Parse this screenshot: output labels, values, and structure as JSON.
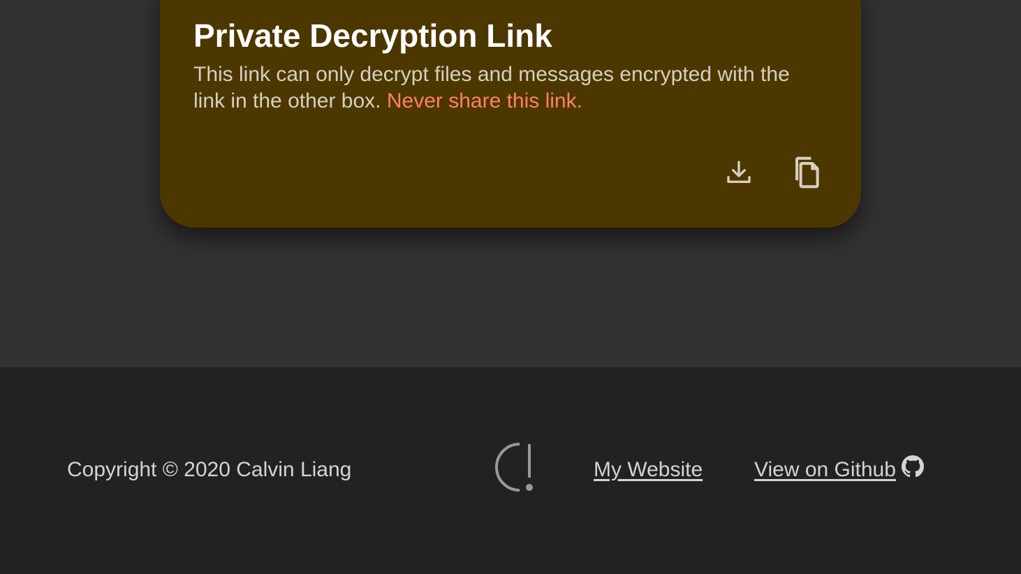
{
  "card": {
    "title": "Private Decryption Link",
    "description": "This link can only decrypt files and messages encrypted with the link in the other box.",
    "warning": "Never share this link.",
    "background_color": "#4c3700",
    "warning_color": "#ff7f70",
    "actions": [
      {
        "icon": "download-icon"
      },
      {
        "icon": "copy-icon"
      }
    ]
  },
  "footer": {
    "copyright": "Copyright © 2020 Calvin Liang",
    "logo": "c-exclamation-logo",
    "website_link": "My Website",
    "github_link": "View on Github",
    "github_icon": "github-icon"
  },
  "colors": {
    "main_background": "#323232",
    "footer_background": "#222222"
  }
}
